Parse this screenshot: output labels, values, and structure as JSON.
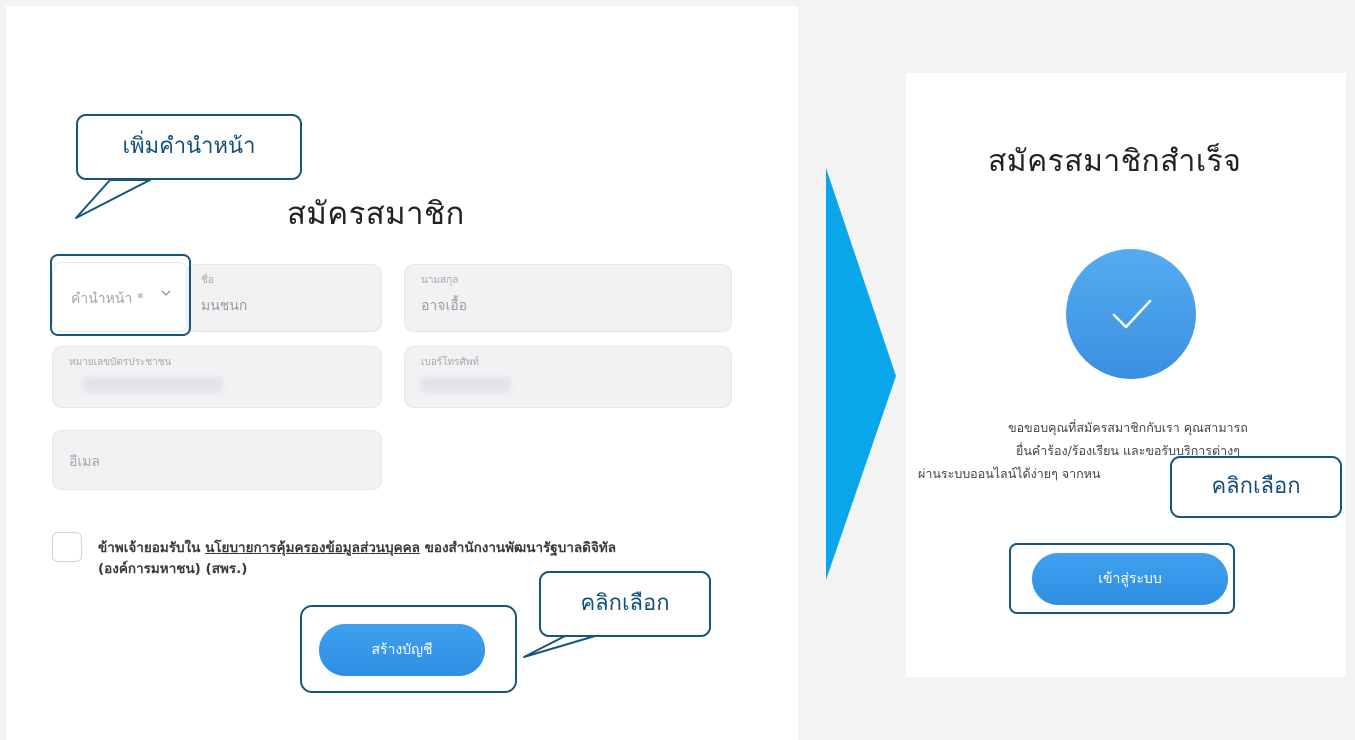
{
  "register_form": {
    "title": "สมัครสมาชิก",
    "prefix_label": "คำนำหน้า *",
    "first_name": {
      "label": "ชื่อ",
      "value": "มนชนก"
    },
    "last_name": {
      "label": "นามสกุล",
      "value": "อาจเอื้อ"
    },
    "id_card": {
      "label": "หมายเลขบัตรประชาชน"
    },
    "phone": {
      "label": "เบอร์โทรศัพท์"
    },
    "email": {
      "placeholder": "อีเมล"
    },
    "consent": {
      "prefix": "ข้าพเจ้ายอมรับใน ",
      "link": "นโยบายการคุ้มครองข้อมูลส่วนบุคคล",
      "suffix": " ของสำนักงานพัฒนารัฐบาลดิจิทัล",
      "line2": "(องค์การมหาชน) (สพร.)"
    },
    "submit_label": "สร้างบัญชี"
  },
  "success_panel": {
    "title": "สมัครสมาชิกสำเร็จ",
    "message_line1": "ขอขอบคุณที่สมัครสมาชิกกับเรา คุณสามารถ",
    "message_line2": "ยื่นคำร้อง/ร้องเรียน และขอรับบริการต่างๆ",
    "message_line3": "ผ่านระบบออนไลน์ได้ง่ายๆ จากหน",
    "login_label": "เข้าสู่ระบบ"
  },
  "callouts": {
    "add_prefix": "เพิ่มคำนำหน้า",
    "click_create": "คลิกเลือก",
    "click_login": "คลิกเลือก"
  },
  "colors": {
    "accent": "#3a97ea",
    "callout_border": "#17557d",
    "arrow": "#0aa6ea"
  },
  "icons": {
    "dropdown": "chevron-down-icon",
    "success": "check-icon",
    "step_arrow": "arrow-right-icon"
  }
}
